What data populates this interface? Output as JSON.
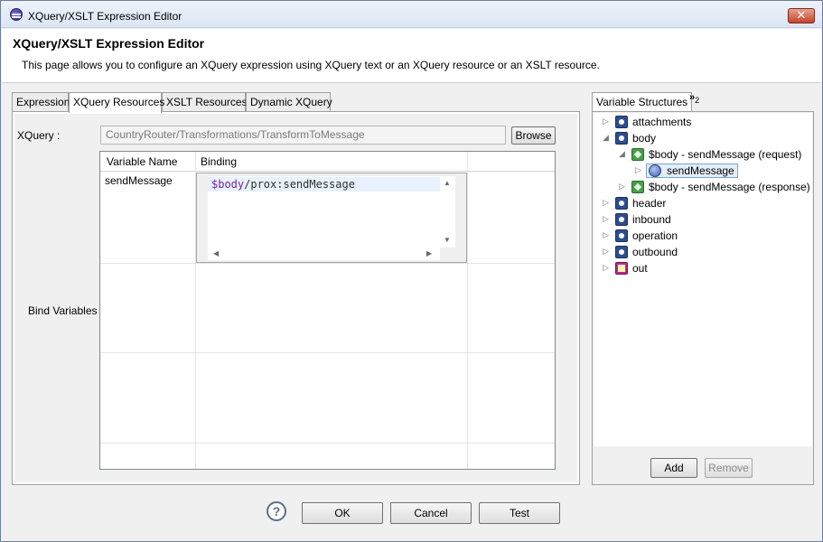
{
  "window": {
    "title": "XQuery/XSLT Expression Editor"
  },
  "header": {
    "heading": "XQuery/XSLT Expression Editor",
    "description": "This page allows you to configure an XQuery expression using XQuery text or an XQuery resource or an XSLT resource."
  },
  "tabs": [
    {
      "label": "Expression"
    },
    {
      "label": "XQuery Resources"
    },
    {
      "label": "XSLT Resources"
    },
    {
      "label": "Dynamic XQuery"
    }
  ],
  "xquery": {
    "label": "XQuery :",
    "value": "CountryRouter/Transformations/TransformToMessage",
    "browse_label": "Browse"
  },
  "bind": {
    "label": "Bind Variables",
    "columns": [
      "Variable Name",
      "Binding"
    ],
    "rows": [
      {
        "variable": "sendMessage",
        "binding_var": "$body",
        "binding_path": "/prox:sendMessage"
      }
    ]
  },
  "right_panel": {
    "tab_label": "Variable Structures",
    "more_label": "»",
    "more_count": "2",
    "tree": [
      {
        "label": "attachments"
      },
      {
        "label": "body"
      },
      {
        "label": "$body - sendMessage (request)"
      },
      {
        "label": "sendMessage"
      },
      {
        "label": "$body - sendMessage (response)"
      },
      {
        "label": "header"
      },
      {
        "label": "inbound"
      },
      {
        "label": "operation"
      },
      {
        "label": "outbound"
      },
      {
        "label": "out"
      }
    ],
    "add_label": "Add",
    "remove_label": "Remove"
  },
  "footer": {
    "help_glyph": "?",
    "ok_label": "OK",
    "cancel_label": "Cancel",
    "test_label": "Test"
  }
}
